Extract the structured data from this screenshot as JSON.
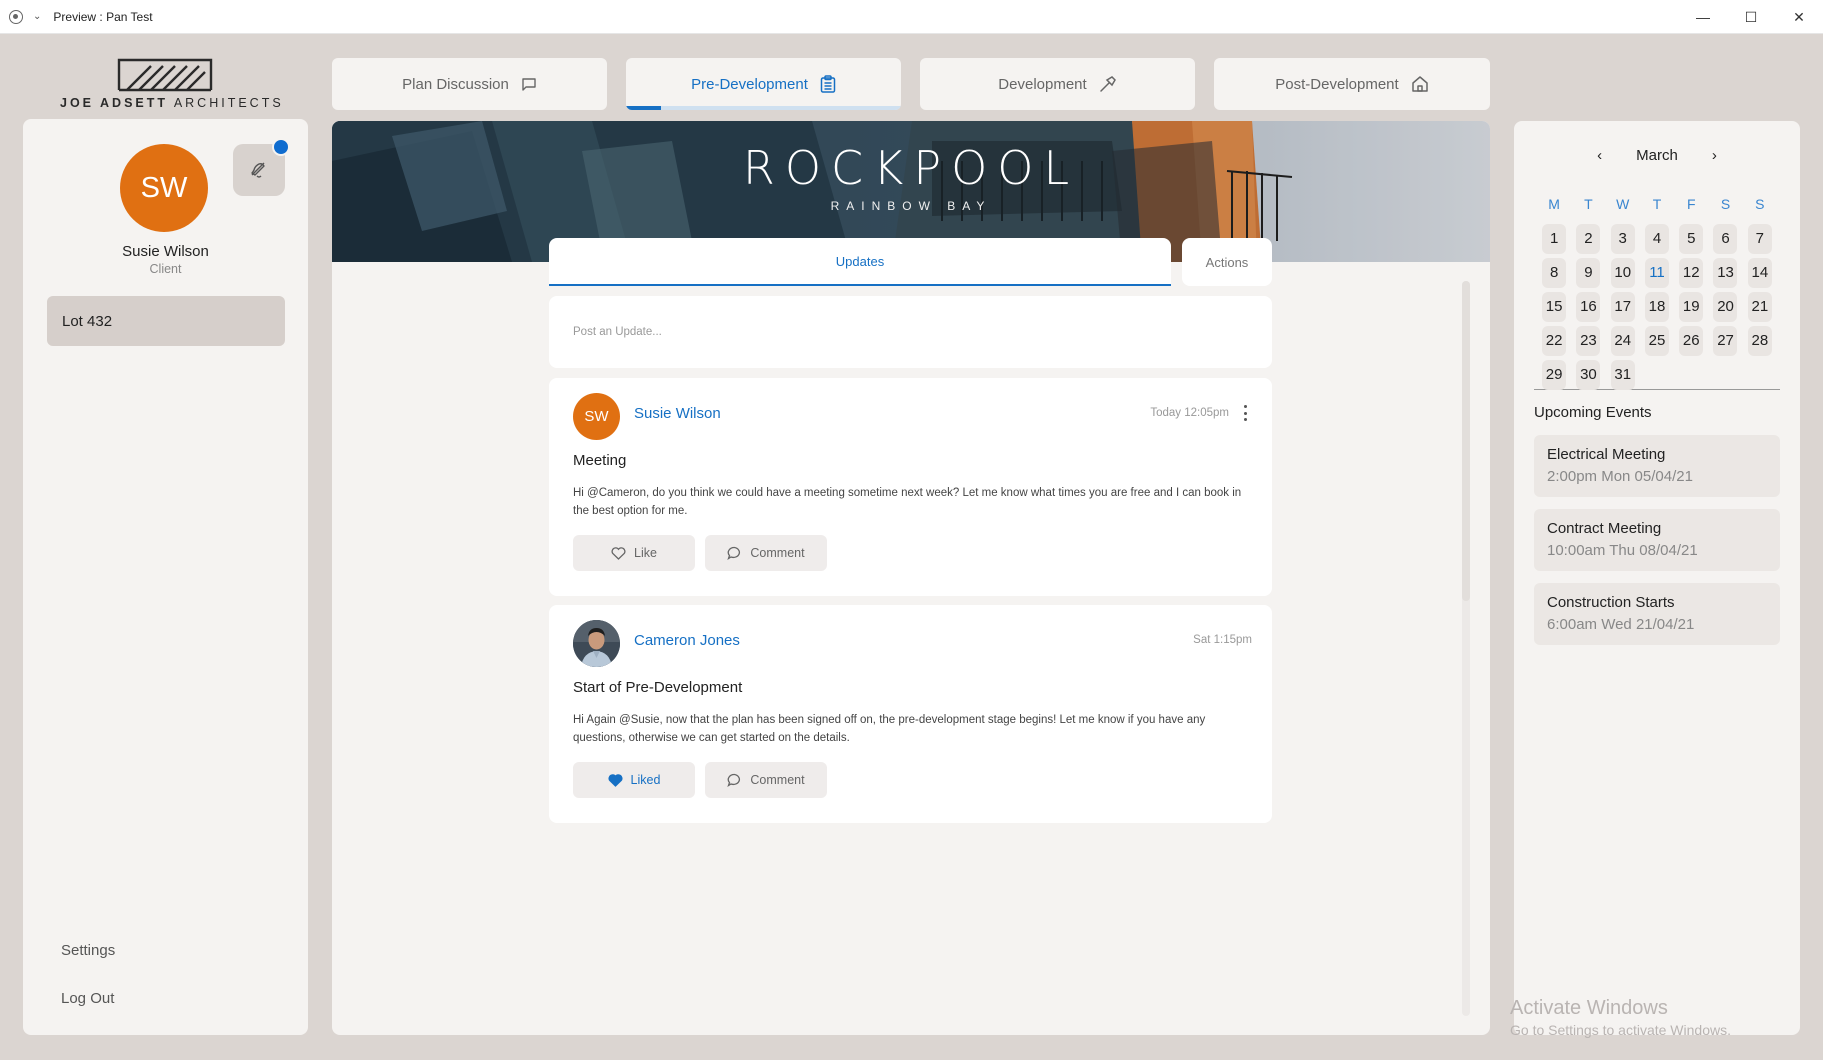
{
  "window": {
    "title": "Preview : Pan Test",
    "minimize": "—",
    "maximize": "☐",
    "close": "✕"
  },
  "logo": {
    "text_bold": "JOE ADSETT",
    "text_light": " ARCHITECTS"
  },
  "user": {
    "initials": "SW",
    "name": "Susie Wilson",
    "role": "Client",
    "avatar_color": "#e07012",
    "has_notification": true
  },
  "lots": [
    {
      "label": "Lot 432",
      "selected": true
    }
  ],
  "nav_bottom": {
    "settings": "Settings",
    "logout": "Log Out"
  },
  "stage_tabs": [
    {
      "label": "Plan Discussion",
      "icon": "chat-bubble-icon",
      "active": false
    },
    {
      "label": "Pre-Development",
      "icon": "clipboard-icon",
      "active": true
    },
    {
      "label": "Development",
      "icon": "hammer-icon",
      "active": false
    },
    {
      "label": "Post-Development",
      "icon": "house-icon",
      "active": false
    }
  ],
  "hero": {
    "title": "ROCKPOOL",
    "subtitle": "RAINBOW BAY"
  },
  "feed_tabs": {
    "updates": "Updates",
    "actions": "Actions"
  },
  "post_box": {
    "placeholder": "Post an Update..."
  },
  "posts": [
    {
      "author": "Susie Wilson",
      "initials": "SW",
      "time": "Today 12:05pm",
      "subject": "Meeting",
      "body": "Hi @Cameron, do you think we could have a meeting sometime next week? Let me know what times you are free and I can book in the best option for me.",
      "like_label": "Like",
      "liked": false,
      "comment_label": "Comment"
    },
    {
      "author": "Cameron Jones",
      "initials": "",
      "time": "Sat 1:15pm",
      "subject": "Start of Pre-Development",
      "body": "Hi Again @Susie, now that the plan has been signed off on, the pre-development stage begins! Let me know if you have any questions, otherwise we can get started on the details.",
      "like_label": "Liked",
      "liked": true,
      "comment_label": "Comment"
    }
  ],
  "calendar": {
    "month": "March",
    "prev": "‹",
    "next": "›",
    "weekdays": [
      "M",
      "T",
      "W",
      "T",
      "F",
      "S",
      "S"
    ],
    "weeks": [
      [
        "1",
        "2",
        "3",
        "4",
        "5",
        "6",
        "7"
      ],
      [
        "8",
        "9",
        "10",
        "11",
        "12",
        "13",
        "14"
      ],
      [
        "15",
        "16",
        "17",
        "18",
        "19",
        "20",
        "21"
      ],
      [
        "22",
        "23",
        "24",
        "25",
        "26",
        "27",
        "28"
      ],
      [
        "29",
        "30",
        "31",
        "",
        "",
        "",
        ""
      ]
    ],
    "today": "11"
  },
  "events": {
    "title": "Upcoming Events",
    "items": [
      {
        "title": "Electrical Meeting",
        "date": "2:00pm Mon 05/04/21"
      },
      {
        "title": "Contract Meeting",
        "date": "10:00am Thu 08/04/21"
      },
      {
        "title": "Construction Starts",
        "date": "6:00am Wed 21/04/21"
      }
    ]
  },
  "watermark": {
    "line1": "Activate Windows",
    "line2": "Go to Settings to activate Windows."
  },
  "colors": {
    "accent": "#1670c4",
    "avatar": "#e07012",
    "background": "#dbd5d1",
    "panel": "#f5f3f1"
  }
}
